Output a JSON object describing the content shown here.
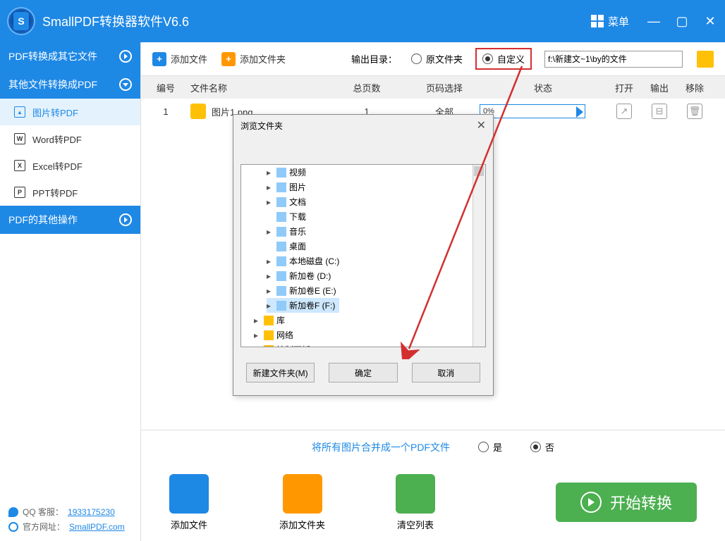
{
  "app": {
    "title": "SmallPDF转换器软件V6.6",
    "menu": "菜单"
  },
  "sidebar": {
    "sections": [
      {
        "label": "PDF转换成其它文件"
      },
      {
        "label": "其他文件转换成PDF"
      },
      {
        "label": "PDF的其他操作"
      }
    ],
    "items": [
      {
        "label": "图片转PDF"
      },
      {
        "label": "Word转PDF"
      },
      {
        "label": "Excel转PDF"
      },
      {
        "label": "PPT转PDF"
      }
    ],
    "footer": {
      "qq_label": "QQ 客服：",
      "qq": "1933175230",
      "site_label": "官方网址：",
      "site": "SmallPDF.com"
    }
  },
  "toolbar": {
    "add_file": "添加文件",
    "add_folder": "添加文件夹",
    "output_label": "输出目录：",
    "radio_src": "原文件夹",
    "radio_custom": "自定义",
    "path": "f:\\新建文~1\\by的文件"
  },
  "table": {
    "headers": {
      "num": "编号",
      "name": "文件名称",
      "pages": "总页数",
      "sel": "页码选择",
      "status": "状态",
      "open": "打开",
      "out": "输出",
      "del": "移除"
    },
    "rows": [
      {
        "num": "1",
        "name": "图片1.png",
        "pages": "1",
        "sel": "全部",
        "status": "0%"
      }
    ]
  },
  "merge": {
    "text": "将所有图片合并成一个PDF文件",
    "yes": "是",
    "no": "否"
  },
  "actions": {
    "add_file": "添加文件",
    "add_folder": "添加文件夹",
    "clear": "清空列表",
    "start": "开始转换"
  },
  "dialog": {
    "title": "浏览文件夹",
    "tree": [
      {
        "label": "视频",
        "exp": "▸"
      },
      {
        "label": "图片",
        "exp": "▸"
      },
      {
        "label": "文档",
        "exp": "▸"
      },
      {
        "label": "下载"
      },
      {
        "label": "音乐",
        "exp": "▸"
      },
      {
        "label": "桌面"
      },
      {
        "label": "本地磁盘 (C:)",
        "exp": "▸"
      },
      {
        "label": "新加卷 (D:)",
        "exp": "▸"
      },
      {
        "label": "新加卷E (E:)",
        "exp": "▸"
      },
      {
        "label": "新加卷F (F:)",
        "exp": "▸",
        "sel": true
      },
      {
        "label": "库",
        "exp": "▸",
        "root": true
      },
      {
        "label": "网络",
        "exp": "▸",
        "root": true
      },
      {
        "label": "控制面板",
        "exp": "▸",
        "root": true
      }
    ],
    "new_folder": "新建文件夹(M)",
    "ok": "确定",
    "cancel": "取消"
  }
}
